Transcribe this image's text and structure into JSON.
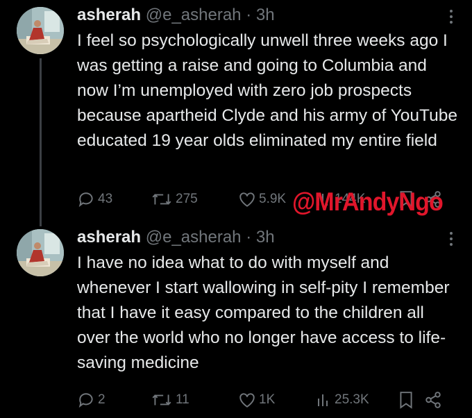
{
  "tweets": [
    {
      "name": "asherah",
      "handle": "@e_asherah",
      "separator": "·",
      "time": "3h",
      "text": "I feel so psychologically unwell three weeks ago I was getting a raise and going to Columbia and now I’m unemployed with zero job prospects because apartheid Clyde and his army of YouTube educated 19 year olds eliminated my entire field",
      "replies": "43",
      "reposts": "275",
      "likes": "5.9K",
      "views": "144K"
    },
    {
      "name": "asherah",
      "handle": "@e_asherah",
      "separator": "·",
      "time": "3h",
      "text": "I have no idea what to do with myself and whenever I start wallowing in self-pity I remember that I have it easy compared to the children all over the world who no longer have access to life-saving medicine",
      "replies": "2",
      "reposts": "11",
      "likes": "1K",
      "views": "25.3K"
    }
  ],
  "watermark": "@MrAndyNgo",
  "colors": {
    "background": "#000000",
    "text": "#e7e9ea",
    "muted": "#71767b",
    "watermark": "#e0162b"
  },
  "icons": [
    "reply-icon",
    "repost-icon",
    "like-icon",
    "views-icon",
    "bookmark-icon",
    "share-icon",
    "more-icon"
  ]
}
